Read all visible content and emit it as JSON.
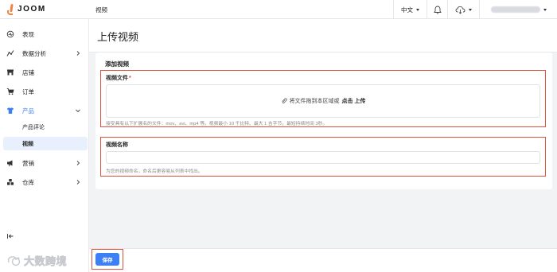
{
  "app": {
    "name": "JOOM",
    "breadcrumb": "视频"
  },
  "topbar": {
    "language": "中文",
    "bell_icon": "bell-icon",
    "cloud_icon": "cloud-download-icon"
  },
  "sidebar": {
    "items": [
      {
        "label": "表现",
        "icon": "performance-icon"
      },
      {
        "label": "数据分析",
        "icon": "analytics-icon",
        "chevron": "right"
      },
      {
        "label": "店铺",
        "icon": "store-icon"
      },
      {
        "label": "订单",
        "icon": "cart-icon"
      },
      {
        "label": "产品",
        "icon": "shirt-icon",
        "chevron": "down",
        "active": true
      },
      {
        "label": "营销",
        "icon": "megaphone-icon",
        "chevron": "right"
      },
      {
        "label": "仓库",
        "icon": "warehouse-icon",
        "chevron": "right"
      }
    ],
    "subitems": [
      {
        "label": "产品评论"
      },
      {
        "label": "视频",
        "selected": true
      }
    ]
  },
  "page": {
    "title": "上传视频"
  },
  "form": {
    "card_title": "添加视频",
    "file_label": "视频文件",
    "required_mark": "*",
    "dropzone_text": "将文件拖到本区域或",
    "upload_link": "点击 上传",
    "file_hint": "接受具有以下扩展名的文件：mov、avi、mp4 等。视频最小 10 千比特、最大 1 吉字节，最短持续时间 3秒。",
    "name_label": "视频名称",
    "name_value": "",
    "name_hint": "为您的视频命名，命名后更容易从列表中找出。"
  },
  "footer": {
    "save_label": "保存"
  },
  "watermark": {
    "text": "大数跨境"
  },
  "colors": {
    "accent": "#3d7ff5",
    "brand": "#f7803c",
    "highlight": "#d9533f"
  }
}
